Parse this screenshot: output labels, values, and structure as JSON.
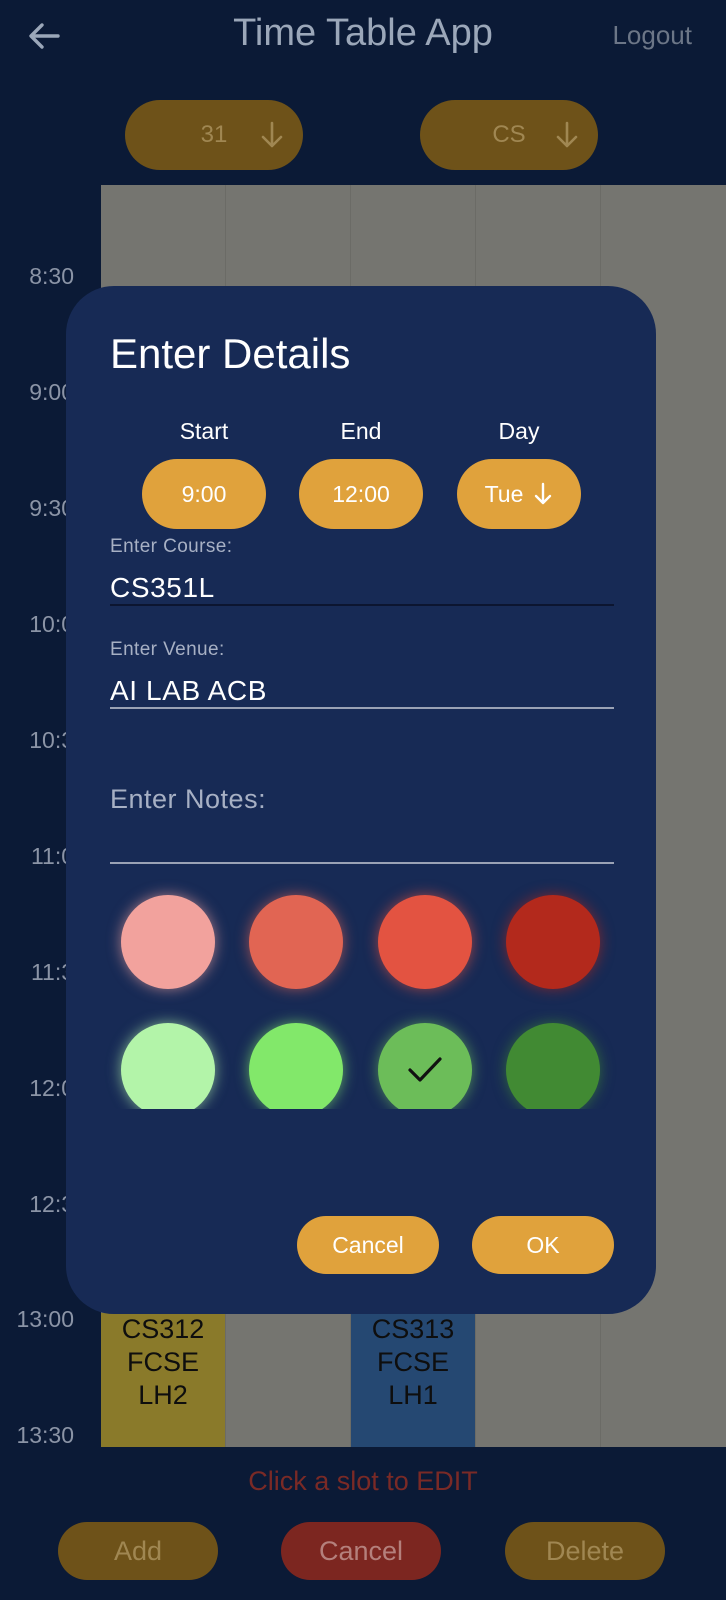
{
  "app": {
    "title": "Time Table App",
    "logout_label": "Logout",
    "semester_selector": {
      "value": "31"
    },
    "department_selector": {
      "value": "CS"
    },
    "time_labels": [
      "8:30",
      "9:00",
      "9:30",
      "10:0",
      "10:3",
      "11:0",
      "11:3",
      "12:0",
      "12:3",
      "13:00",
      "13:30"
    ],
    "slots": [
      {
        "lines": [
          "CS312",
          "FCSE",
          "LH2"
        ],
        "color": "#8a7a2a"
      },
      {
        "lines": [
          "CS313",
          "FCSE",
          "LH1"
        ],
        "color": "#254872"
      }
    ],
    "hint": "Click a slot to EDIT",
    "bottom_buttons": {
      "add": "Add",
      "cancel": "Cancel",
      "delete": "Delete"
    }
  },
  "dialog": {
    "title": "Enter Details",
    "start": {
      "label": "Start",
      "value": "9:00"
    },
    "end": {
      "label": "End",
      "value": "12:00"
    },
    "day": {
      "label": "Day",
      "value": "Tue"
    },
    "course": {
      "label": "Enter Course:",
      "value": "CS351L"
    },
    "venue": {
      "label": "Enter Venue:",
      "value": "AI LAB ACB"
    },
    "notes": {
      "placeholder": "Enter Notes:",
      "value": ""
    },
    "colors": [
      "#f2a29d",
      "#e16553",
      "#e35341",
      "#b3291c",
      "#b3f4a9",
      "#82e86a",
      "#6cbd59",
      "#418a33"
    ],
    "selected_color_index": 6,
    "cancel_label": "Cancel",
    "ok_label": "OK"
  }
}
